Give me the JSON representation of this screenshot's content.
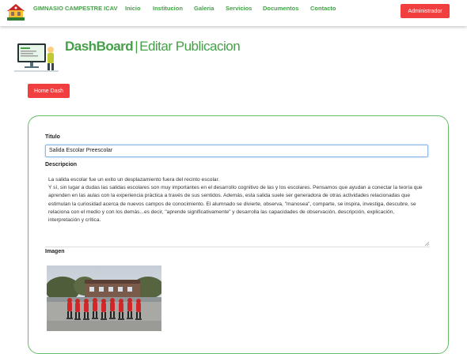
{
  "navbar": {
    "brand": "GIMNASIO CAMPESTRE ICAV",
    "links": [
      "Inicio",
      "Institucion",
      "Galeria",
      "Servicios",
      "Documentos",
      "Contacto"
    ],
    "admin_label": "Administrador"
  },
  "header": {
    "title_strong": "DashBoard",
    "separator": "|",
    "title_rest": "Editar Publicacion",
    "home_label": "Home Dash"
  },
  "form": {
    "title_label": "Titulo",
    "title_value": "Salida Escolar Preescolar",
    "description_label": "Descripcion",
    "description_lines": [
      "La salida escolar fue un exito un desplazamiento fuera del recinto escolar.",
      "Y sí, sin lugar a dudas las salidas escolares son muy importantes en el desarrollo cognitivo de las y los escolares. Pensamos que ayudan a conectar la teoría que aprenden en las aulas con la experiencia práctica a través de sus sentidos. Además, esta salida suele ser generadora de otras actividades relacionadas que estimulan la curiosidad acerca de nuevos campos de conocimiento. El alumnado se divierte, observa, \"manosea\", comparte, se inspira, investiga, descubre, se relaciona con el medio y con los demás...es decir, \"aprende significativamente\" y desarrolla las capacidades de observación, descripción, explicación, interpretación y crítica."
    ],
    "image_label": "Imagen"
  },
  "colors": {
    "brand_green": "#43a047",
    "button_red": "#f13f3f",
    "card_border": "#66bb6a"
  }
}
